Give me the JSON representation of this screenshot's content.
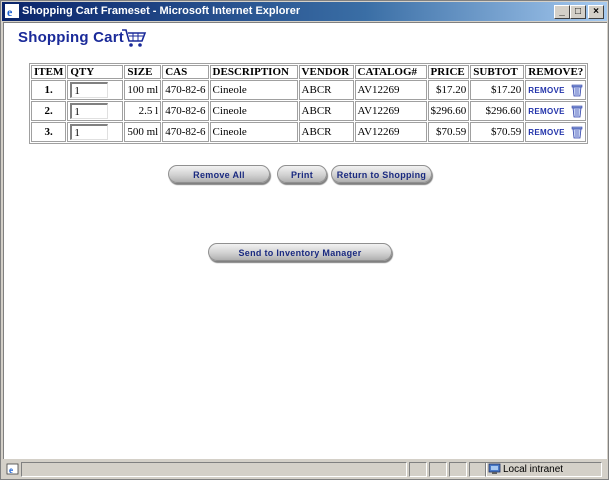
{
  "window": {
    "title": "Shopping Cart Frameset - Microsoft Internet Explorer",
    "minimize": "_",
    "maximize": "□",
    "close": "×"
  },
  "page": {
    "heading": "Shopping Cart"
  },
  "table": {
    "headers": [
      "ITEM",
      "QTY",
      "SIZE",
      "CAS",
      "DESCRIPTION",
      "VENDOR",
      "CATALOG#",
      "PRICE",
      "SUBTOT",
      "REMOVE?"
    ],
    "rows": [
      {
        "item": "1.",
        "qty": "1",
        "size": "100 ml",
        "cas": "470-82-6",
        "description": "Cineole",
        "vendor": "ABCR",
        "catalog": "AV12269",
        "price": "$17.20",
        "subtot": "$17.20",
        "remove": "REMOVE"
      },
      {
        "item": "2.",
        "qty": "1",
        "size": "2.5 l",
        "cas": "470-82-6",
        "description": "Cineole",
        "vendor": "ABCR",
        "catalog": "AV12269",
        "price": "$296.60",
        "subtot": "$296.60",
        "remove": "REMOVE"
      },
      {
        "item": "3.",
        "qty": "1",
        "size": "500 ml",
        "cas": "470-82-6",
        "description": "Cineole",
        "vendor": "ABCR",
        "catalog": "AV12269",
        "price": "$70.59",
        "subtot": "$70.59",
        "remove": "REMOVE"
      }
    ]
  },
  "buttons": {
    "remove_all": "Remove All",
    "print": "Print",
    "return_shopping": "Return to Shopping",
    "send_inventory": "Send to Inventory Manager"
  },
  "status": {
    "zone": "Local intranet"
  },
  "icons": {
    "title": "ie-icon",
    "cart": "shopping-cart-icon",
    "trash": "trash-icon",
    "status_page": "page-icon",
    "zone": "intranet-icon"
  }
}
